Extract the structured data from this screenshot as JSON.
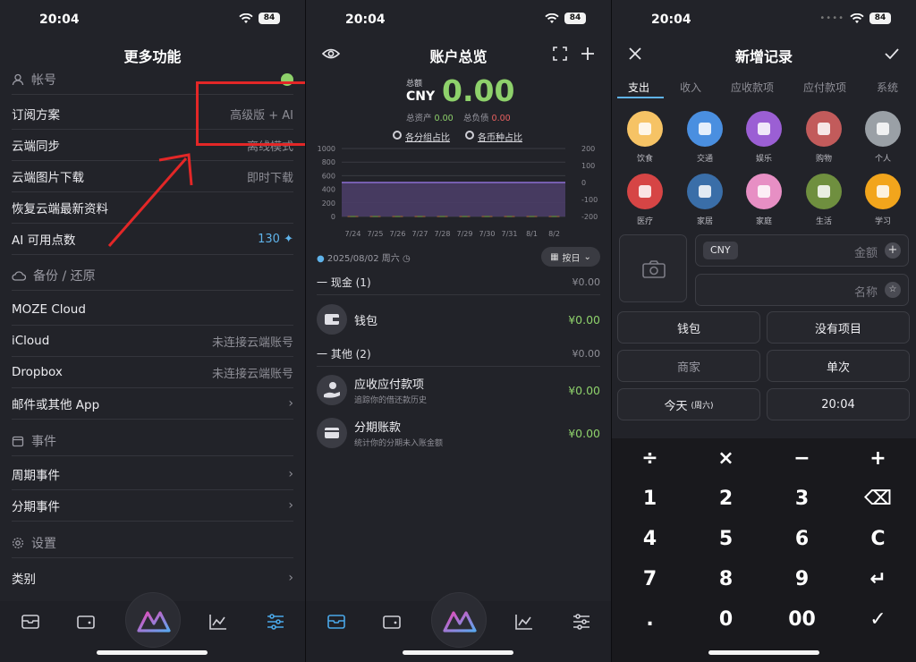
{
  "status": {
    "time": "20:04",
    "battery": "84"
  },
  "more": {
    "title": "更多功能",
    "account_section": "帐号",
    "rows": [
      {
        "label": "订阅方案",
        "value": "高级版 + AI"
      },
      {
        "label": "云端同步",
        "value": "离线模式"
      },
      {
        "label": "云端图片下载",
        "value": "即时下载"
      },
      {
        "label": "恢复云端最新资料",
        "value": ""
      },
      {
        "label": "AI 可用点数",
        "value": "130"
      }
    ],
    "backup_section": "备份 / 还原",
    "backup_rows": [
      {
        "label": "MOZE Cloud",
        "value": ""
      },
      {
        "label": "iCloud",
        "value": "未连接云端账号"
      },
      {
        "label": "Dropbox",
        "value": "未连接云端账号"
      },
      {
        "label": "邮件或其他 App",
        "value": ""
      }
    ],
    "events_section": "事件",
    "event_rows": [
      {
        "label": "周期事件"
      },
      {
        "label": "分期事件"
      }
    ],
    "settings_section": "设置",
    "settings_rows": [
      {
        "label": "类别"
      }
    ]
  },
  "overview": {
    "title": "账户总览",
    "total_label": "总额",
    "currency": "CNY",
    "total": "0.00",
    "assets_label": "总资产",
    "assets": "0.00",
    "liab_label": "总负债",
    "liab": "0.00",
    "link1": "各分组占比",
    "link2": "各币种占比",
    "date": "2025/08/02 周六",
    "period": "按日",
    "groups": [
      {
        "name": "一 现金 (1)",
        "amount": "¥0.00"
      },
      {
        "name": "一 其他 (2)",
        "amount": "¥0.00"
      }
    ],
    "accounts": [
      {
        "name": "钱包",
        "desc": "",
        "amount": "¥0.00"
      },
      {
        "name": "应收应付款项",
        "desc": "追踪你的借还款历史",
        "amount": "¥0.00"
      },
      {
        "name": "分期账款",
        "desc": "统计你的分期未入账金额",
        "amount": "¥0.00"
      }
    ]
  },
  "chart_data": {
    "type": "area",
    "categories": [
      "7/24",
      "7/25",
      "7/26",
      "7/27",
      "7/28",
      "7/29",
      "7/30",
      "7/31",
      "8/1",
      "8/2"
    ],
    "series": [
      {
        "values": [
          0,
          0,
          0,
          0,
          0,
          0,
          0,
          0,
          0,
          0
        ]
      },
      {
        "values": [
          0,
          0,
          0,
          0,
          0,
          0,
          0,
          0,
          0,
          0
        ]
      }
    ],
    "left_ticks": [
      "1000",
      "800",
      "600",
      "400",
      "200",
      "0"
    ],
    "right_ticks": [
      "200",
      "100",
      "0",
      "-100",
      "-200"
    ],
    "ylim_left": [
      0,
      1000
    ],
    "ylim_right": [
      -200,
      200
    ],
    "grid": true
  },
  "record": {
    "title": "新增记录",
    "tabs": [
      "支出",
      "收入",
      "应收款项",
      "应付款项",
      "系统"
    ],
    "categories": [
      {
        "label": "饮食",
        "color": "#f6c365",
        "icon": "fork-knife-icon"
      },
      {
        "label": "交通",
        "color": "#4a8fe0",
        "icon": "road-icon"
      },
      {
        "label": "娱乐",
        "color": "#9b5fd4",
        "icon": "microphone-icon"
      },
      {
        "label": "购物",
        "color": "#c25b5b",
        "icon": "snow-globe-icon"
      },
      {
        "label": "个人",
        "color": "#9aa0a6",
        "icon": "person-icon"
      },
      {
        "label": "医疗",
        "color": "#d64545",
        "icon": "hospital-icon"
      },
      {
        "label": "家居",
        "color": "#3a6ea8",
        "icon": "house-icon"
      },
      {
        "label": "家庭",
        "color": "#e78fc4",
        "icon": "family-icon"
      },
      {
        "label": "生活",
        "color": "#6f8f3f",
        "icon": "plant-icon"
      },
      {
        "label": "学习",
        "color": "#f2a51c",
        "icon": "books-icon"
      }
    ],
    "currency": "CNY",
    "amount_placeholder": "金额",
    "name_placeholder": "名称",
    "fields": [
      {
        "label": "钱包"
      },
      {
        "label": "没有项目"
      },
      {
        "label": "商家"
      },
      {
        "label": "单次"
      },
      {
        "label": "今天",
        "extra": "(周六)"
      },
      {
        "label": "20:04"
      }
    ],
    "keys": [
      "÷",
      "×",
      "−",
      "+",
      "1",
      "2",
      "3",
      "⌫",
      "4",
      "5",
      "6",
      "C",
      "7",
      "8",
      "9",
      "↵",
      ".",
      "0",
      "00",
      "✓"
    ]
  }
}
